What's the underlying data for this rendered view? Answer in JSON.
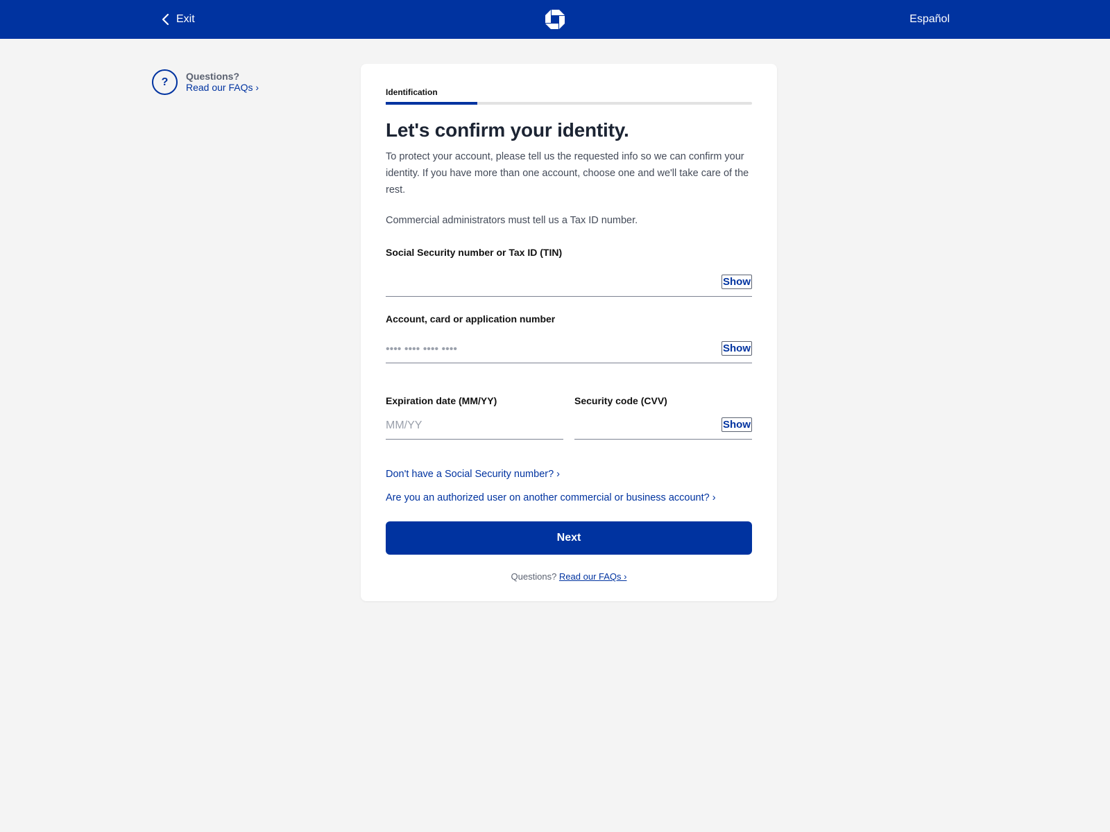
{
  "header": {
    "exit_label": "Exit",
    "language_label": "Español",
    "brand_color": "#0033a0"
  },
  "side_help": {
    "question": "Questions?",
    "faq_link": "Read our FAQs ›"
  },
  "progress": {
    "step_label": "Identification",
    "fraction_complete": 0.25
  },
  "main": {
    "title": "Let's confirm your identity.",
    "intro": "To protect your account, please tell us the requested info so we can confirm your identity. If you have more than one account, choose one and we'll take care of the rest.",
    "admin_note": "Commercial administrators must tell us a Tax ID number."
  },
  "fields": {
    "ssn": {
      "label": "Social Security number or Tax ID (TIN)",
      "value": "",
      "placeholder": "",
      "show_label": "Show"
    },
    "account": {
      "label": "Account, card or application number",
      "value": "",
      "placeholder": "•••• •••• •••• ••••",
      "show_label": "Show"
    },
    "expiration": {
      "label": "Expiration date (MM/YY)",
      "value": "",
      "placeholder": "MM/YY"
    },
    "cvv": {
      "label": "Security code (CVV)",
      "value": "",
      "placeholder": "",
      "show_label": "Show"
    }
  },
  "links": {
    "no_ssn": "Don't have a Social Security number? ›",
    "authorized_user": "Are you an authorized user on another commercial or business account? ›"
  },
  "actions": {
    "next_label": "Next"
  },
  "footer": {
    "question": "Questions?",
    "faq_link": "Read our FAQs ›"
  }
}
